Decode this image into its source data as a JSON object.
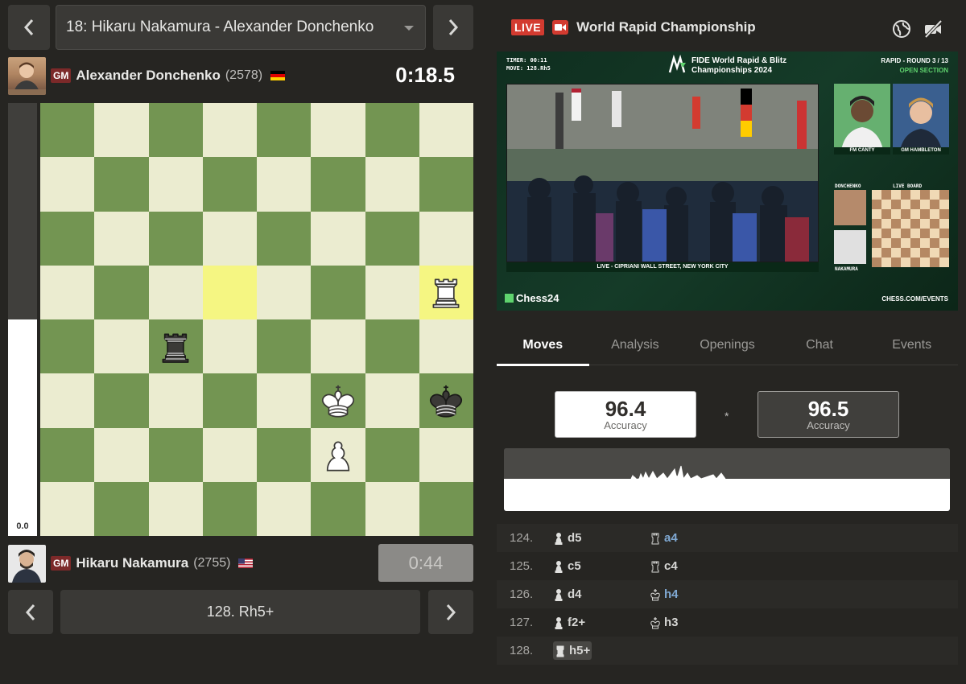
{
  "game_selector": {
    "value": "18: Hikaru Nakamura - Alexander Donchenko"
  },
  "top_player": {
    "title": "GM",
    "name": "Alexander Donchenko",
    "rating": "(2578)",
    "clock": "0:18.5",
    "flag": "germany"
  },
  "bottom_player": {
    "title": "GM",
    "name": "Hikaru Nakamura",
    "rating": "(2755)",
    "clock": "0:44",
    "flag": "usa"
  },
  "eval_bar": {
    "label": "0.0",
    "white_fraction": 0.5
  },
  "move_nav": {
    "label": "128. Rh5+"
  },
  "board": {
    "last_move": [
      "d5",
      "h5"
    ],
    "pieces": [
      {
        "square": "h5",
        "piece": "white-rook"
      },
      {
        "square": "c4",
        "piece": "black-rook"
      },
      {
        "square": "f3",
        "piece": "white-king"
      },
      {
        "square": "h3",
        "piece": "black-king"
      },
      {
        "square": "f2",
        "piece": "white-pawn"
      }
    ]
  },
  "broadcast": {
    "live_label": "LIVE",
    "title": "World Rapid Championship",
    "timer": "TIMER: 00:11",
    "move": "MOVE: 128.Rh5",
    "event_line1": "FIDE World Rapid & Blitz",
    "event_line2": "Championships 2024",
    "round": "RAPID - ROUND 3 / 13",
    "section": "OPEN SECTION",
    "location": "LIVE - CIPRIANI WALL STREET, NEW YORK CITY",
    "cam1_name": "FM CANTY",
    "cam2_name": "GM HAMBLETON",
    "mini_top": "DONCHENKO",
    "mini_bottom": "NAKAMURA",
    "mini_board_label": "LIVE BOARD",
    "footer_left": "Chess24",
    "footer_right": "CHESS.COM/EVENTS"
  },
  "tabs": [
    "Moves",
    "Analysis",
    "Openings",
    "Chat",
    "Events"
  ],
  "accuracy": {
    "white": {
      "value": "96.4",
      "label": "Accuracy"
    },
    "separator": "*",
    "black": {
      "value": "96.5",
      "label": "Accuracy"
    }
  },
  "moves": [
    {
      "num": "124.",
      "white": "d5",
      "white_piece": "pawn",
      "black": "a4",
      "black_piece": "rook",
      "black_blue": true
    },
    {
      "num": "125.",
      "white": "c5",
      "white_piece": "pawn",
      "black": "c4",
      "black_piece": "rook",
      "black_blue": false
    },
    {
      "num": "126.",
      "white": "d4",
      "white_piece": "pawn",
      "black": "h4",
      "black_piece": "king",
      "black_blue": true
    },
    {
      "num": "127.",
      "white": "f2+",
      "white_piece": "pawn",
      "black": "h3",
      "black_piece": "king",
      "black_blue": false
    },
    {
      "num": "128.",
      "white": "h5+",
      "white_piece": "rook",
      "black": "",
      "black_piece": "",
      "black_blue": false
    }
  ]
}
